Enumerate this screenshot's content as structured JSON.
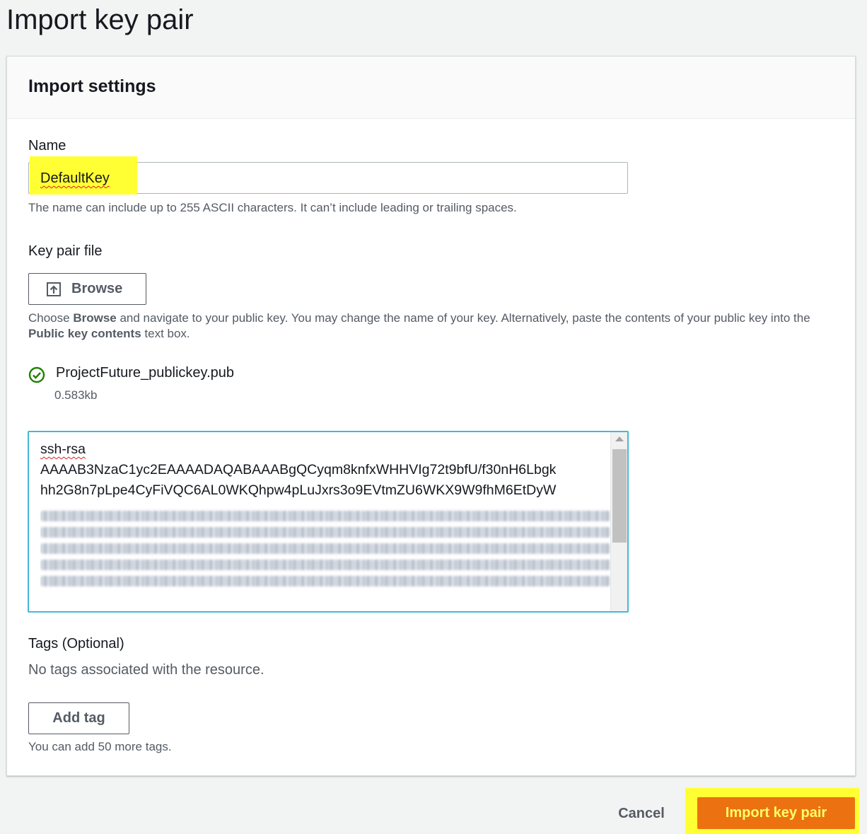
{
  "page": {
    "title": "Import key pair"
  },
  "import_settings": {
    "heading": "Import settings",
    "name": {
      "label": "Name",
      "value": "DefaultKey",
      "hint": "The name can include up to 255 ASCII characters. It can’t include leading or trailing spaces."
    },
    "key_pair_file": {
      "label": "Key pair file",
      "browse_label": "Browse",
      "hint_prefix": "Choose ",
      "hint_browse": "Browse",
      "hint_middle": " and navigate to your public key. You may change the name of your key. Alternatively, paste the contents of your public key into the ",
      "hint_public_key": "Public key contents",
      "hint_suffix": " text box.",
      "file_name": "ProjectFuture_publickey.pub",
      "file_size": "0.583kb"
    },
    "public_key": {
      "line1": "ssh-rsa",
      "line2": "AAAAB3NzaC1yc2EAAAADAQABAAABgQCyqm8knfxWHHVIg72t9bfU/f30nH6Lbgk",
      "line3": "hh2G8n7pLpe4CyFiVQC6AL0WKQhpw4pLuJxrs3o9EVtmZU6WKX9W9fhM6EtDyW"
    },
    "tags": {
      "label": "Tags (Optional)",
      "empty_text": "No tags associated with the resource.",
      "add_label": "Add tag",
      "limit_hint": "You can add 50 more tags."
    }
  },
  "footer": {
    "cancel_label": "Cancel",
    "submit_label": "Import key pair"
  },
  "colors": {
    "primary": "#ec7211",
    "highlight": "#ffff33",
    "focus_border": "#44b9d6",
    "success": "#1d8102"
  },
  "icons": {
    "browse": "upload-icon",
    "file_status": "check-circle-icon"
  }
}
